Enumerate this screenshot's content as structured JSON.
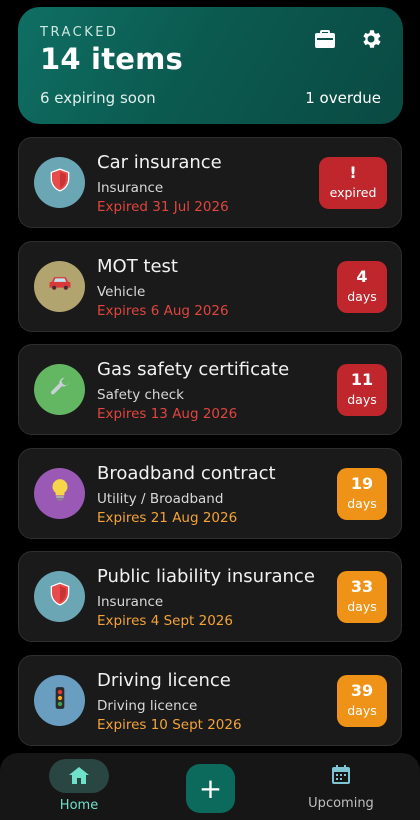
{
  "header": {
    "label": "TRACKED",
    "count": "14 items",
    "expiring": "6 expiring soon",
    "overdue": "1 overdue",
    "icons": [
      "briefcase-icon",
      "gear-icon"
    ]
  },
  "items": [
    {
      "title": "Car insurance",
      "category": "Insurance",
      "expiry": "Expired 31 Jul 2026",
      "badge_top": "!",
      "badge_bottom": "expired",
      "status": "overdue",
      "icon": "shield-icon",
      "avatar_color": "#6aa6b4",
      "badge_color": "#c0272d",
      "expiry_color": "#e0453f"
    },
    {
      "title": "MOT test",
      "category": "Vehicle",
      "expiry": "Expires 6 Aug 2026",
      "badge_top": "4",
      "badge_bottom": "days",
      "status": "urgent",
      "icon": "car-icon",
      "avatar_color": "#b2a46e",
      "badge_color": "#c0272d",
      "expiry_color": "#e0453f"
    },
    {
      "title": "Gas safety certificate",
      "category": "Safety check",
      "expiry": "Expires 13 Aug 2026",
      "badge_top": "11",
      "badge_bottom": "days",
      "status": "urgent",
      "icon": "wrench-icon",
      "avatar_color": "#63b763",
      "badge_color": "#c0272d",
      "expiry_color": "#e0453f"
    },
    {
      "title": "Broadband contract",
      "category": "Utility / Broadband",
      "expiry": "Expires 21 Aug 2026",
      "badge_top": "19",
      "badge_bottom": "days",
      "status": "soon",
      "icon": "lightbulb-icon",
      "avatar_color": "#9b59b6",
      "badge_color": "#ee9318",
      "expiry_color": "#f3a33a"
    },
    {
      "title": "Public liability insurance",
      "category": "Insurance",
      "expiry": "Expires 4 Sept 2026",
      "badge_top": "33",
      "badge_bottom": "days",
      "status": "soon",
      "icon": "shield-icon",
      "avatar_color": "#6aa6b4",
      "badge_color": "#ee9318",
      "expiry_color": "#f3a33a"
    },
    {
      "title": "Driving licence",
      "category": "Driving licence",
      "expiry": "Expires 10 Sept 2026",
      "badge_top": "39",
      "badge_bottom": "days",
      "status": "soon",
      "icon": "traffic-light-icon",
      "avatar_color": "#6a9ec0",
      "badge_color": "#ee9318",
      "expiry_color": "#f3a33a"
    }
  ],
  "nav": {
    "home_label": "Home",
    "add_label": "+",
    "upcoming_label": "Upcoming",
    "accent": "#0c6a5c"
  }
}
